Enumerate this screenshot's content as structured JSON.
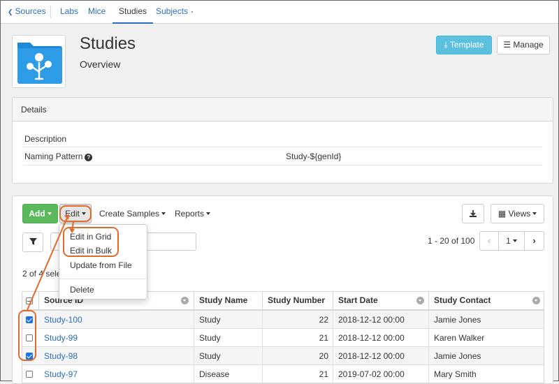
{
  "nav": {
    "back": "Sources",
    "tabs": [
      {
        "label": "Labs"
      },
      {
        "label": "Mice"
      },
      {
        "label": "Studies"
      },
      {
        "label": "Subjects"
      }
    ]
  },
  "header": {
    "title": "Studies",
    "subtitle": "Overview",
    "template_button": "Template",
    "manage_button": "Manage"
  },
  "details": {
    "heading": "Details",
    "description_label": "Description",
    "naming_label": "Naming Pattern",
    "naming_value": "Study-${genId}"
  },
  "toolbar": {
    "add": "Add",
    "edit": "Edit",
    "create_samples": "Create Samples",
    "reports": "Reports",
    "views": "Views"
  },
  "edit_menu": {
    "items": [
      "Edit in Grid",
      "Edit in Bulk",
      "Update from File",
      "Delete"
    ]
  },
  "pagination": {
    "range": "1 - 20 of 100",
    "page": "1"
  },
  "selection_info": "2 of 4 sele",
  "table": {
    "columns": [
      "Source ID",
      "Study Name",
      "Study Number",
      "Start Date",
      "Study Contact"
    ],
    "rows": [
      {
        "checked": true,
        "id": "Study-100",
        "name": "Study",
        "number": "22",
        "date": "2018-12-12 00:00",
        "contact": "Jamie Jones"
      },
      {
        "checked": false,
        "id": "Study-99",
        "name": "Study",
        "number": "21",
        "date": "2018-12-12 00:00",
        "contact": "Karen Walker"
      },
      {
        "checked": true,
        "id": "Study-98",
        "name": "Study",
        "number": "20",
        "date": "2018-12-12 00:00",
        "contact": "Jamie Jones"
      },
      {
        "checked": false,
        "id": "Study-97",
        "name": "Disease",
        "number": "21",
        "date": "2019-07-02 00:00",
        "contact": "Mary Smith"
      }
    ]
  },
  "colors": {
    "accent": "#2a6ebb",
    "add_green": "#5cb85c",
    "template_blue": "#5bc0de",
    "annotation_orange": "#e06a2b",
    "checkbox_blue": "#1a73e8"
  }
}
